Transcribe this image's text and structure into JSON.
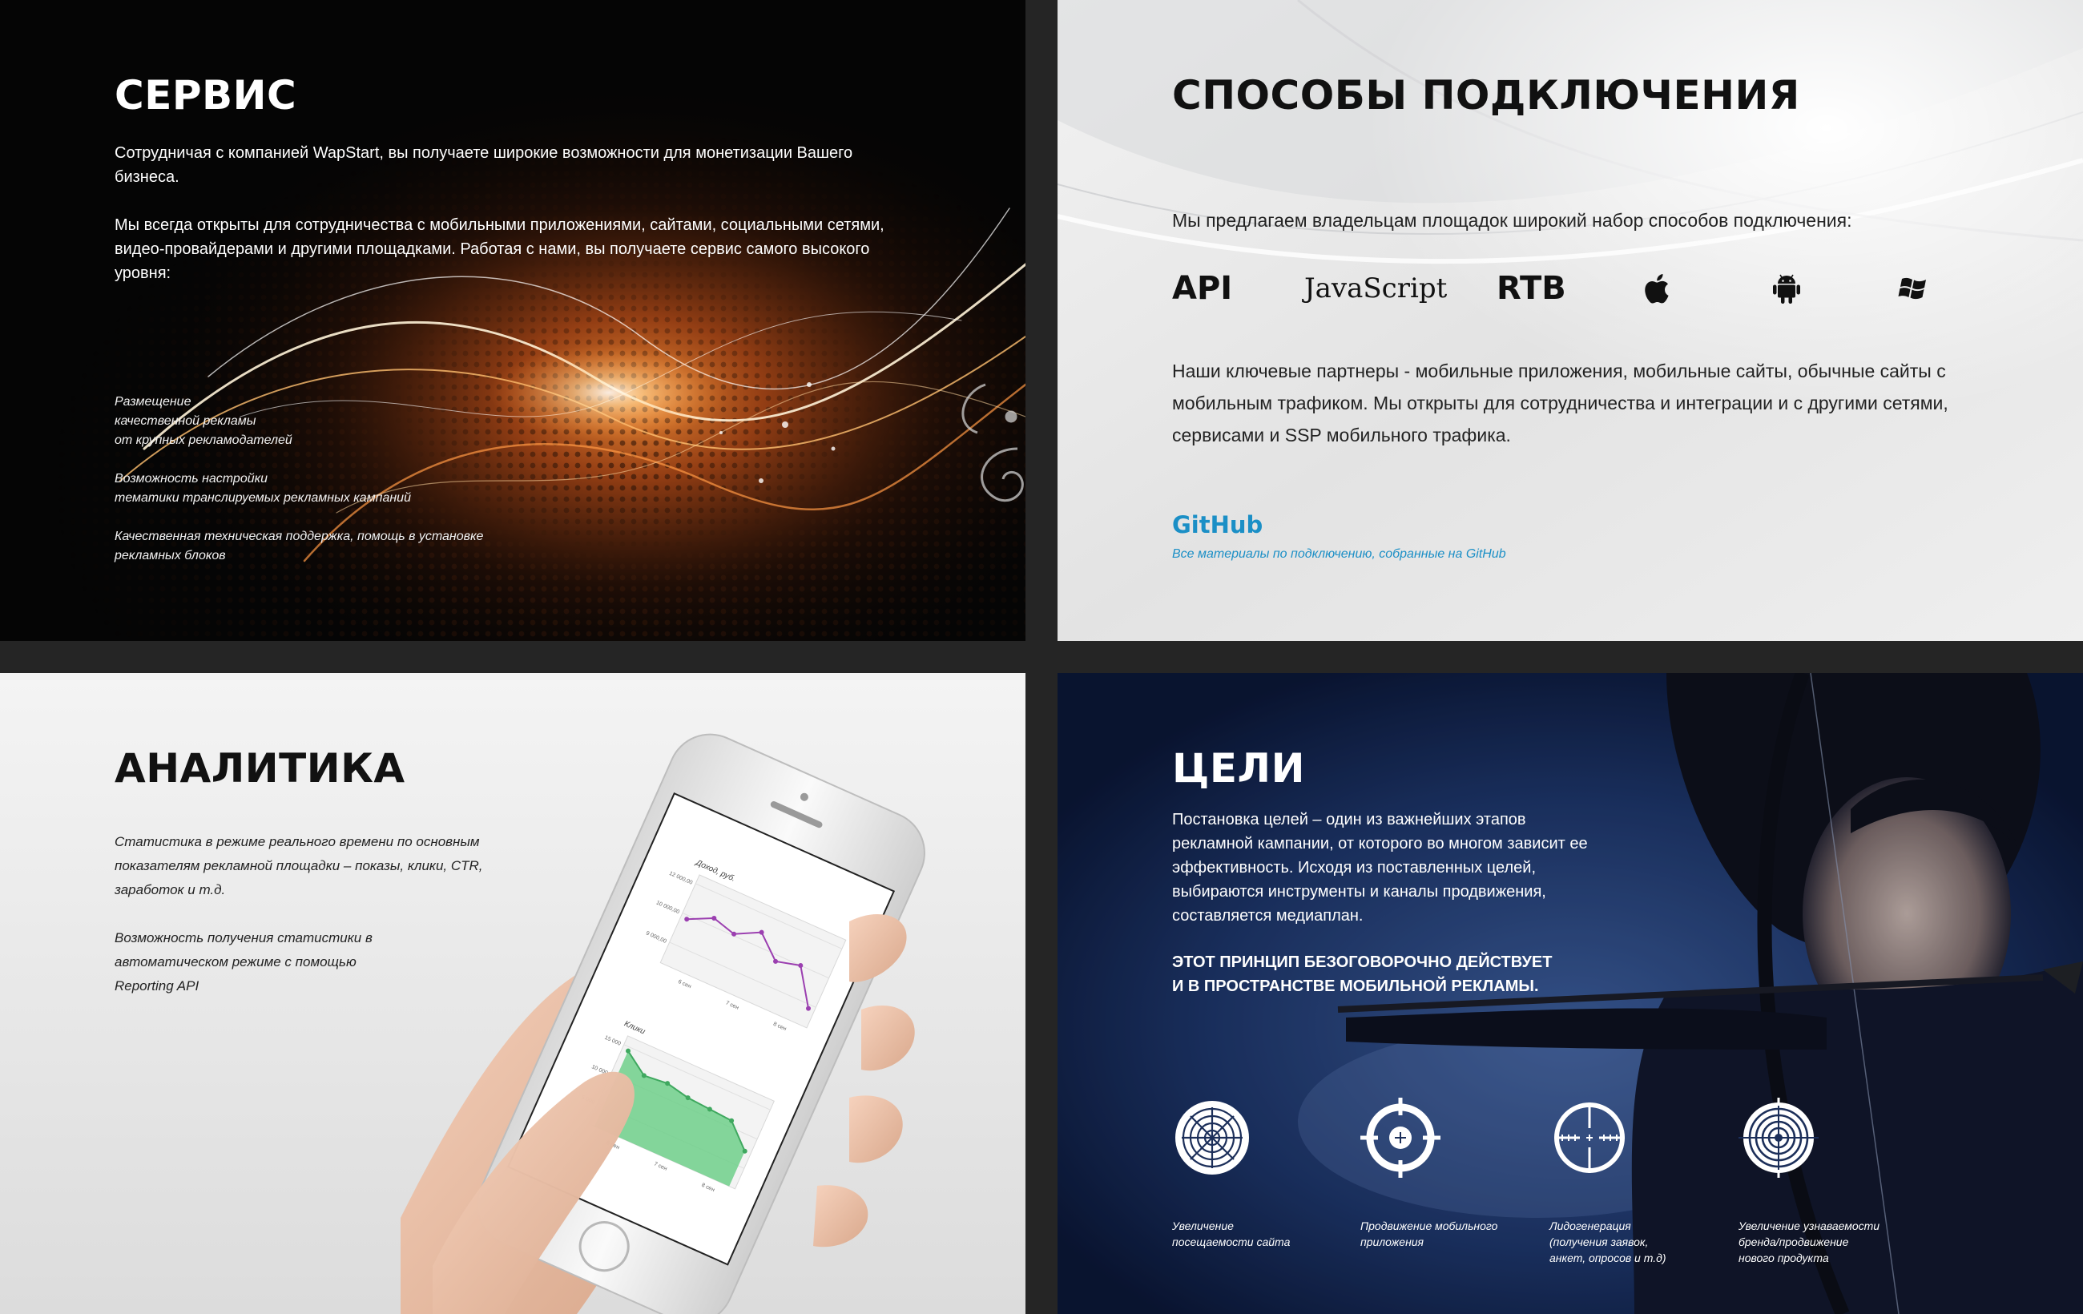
{
  "service": {
    "title": "СЕРВИС",
    "paragraph1": "Сотрудничая с компанией WapStart, вы получаете широкие возможности для монетизации Вашего бизнеса.",
    "paragraph2": "Мы всегда открыты для сотрудничества с мобильными приложениями, сайтами, социальными сетями, видео-провайдерами и другими площадками. Работая с нами, вы получаете сервис самого высокого уровня:",
    "features": [
      "Размещение\nкачественной рекламы\nот крупных рекламодателей",
      "Возможность настройки\nтематики транслируемых рекламных кампаний",
      "Качественная техническая поддержка, помощь в установке\nрекламных блоков"
    ]
  },
  "connect": {
    "title": "СПОСОБЫ ПОДКЛЮЧЕНИЯ",
    "intro": "Мы предлагаем владельцам площадок широкий набор способов подключения:",
    "methods": [
      "API",
      "JavaScript",
      "RTB"
    ],
    "platform_icons": [
      "apple-icon",
      "android-icon",
      "windows-icon"
    ],
    "partners": "Наши ключевые партнеры - мобильные приложения, мобильные сайты, обычные сайты с мобильным трафиком. Мы открыты для сотрудничества и интеграции и с другими сетями, сервисами и SSP мобильного трафика.",
    "github_label": "GitHub",
    "github_sub": "Все материалы по подключению, собранные на GitHub",
    "link_color": "#1b8fc6"
  },
  "analytics": {
    "title": "АНАЛИТИКА",
    "text1": "Статистика в режиме реального времени по основным показателям рекламной площадки – показы, клики, CTR, заработок и т.д.",
    "text2": "Возможность получения статистики в автоматическом режиме с помощью Reporting API",
    "phone_charts": {
      "income": {
        "title": "Доход, руб.",
        "ticks": [
          "12 000,00",
          "10 000,00",
          "9 000,00"
        ],
        "x_labels": [
          "6 сен",
          "7 сен",
          "8 сен"
        ],
        "values": [
          0.55,
          0.7,
          0.62,
          0.78,
          0.52,
          0.6,
          0.15
        ],
        "color": "#9b3fb0"
      },
      "clicks": {
        "title": "Клики",
        "ticks": [
          "15 000",
          "10 000",
          "5 000"
        ],
        "x_labels": [
          "6 сен",
          "7 сен",
          "8 сен"
        ],
        "values": [
          0.95,
          0.75,
          0.78,
          0.72,
          0.7,
          0.68,
          0.4
        ],
        "color": "#6fcf8a"
      }
    }
  },
  "goals": {
    "title": "ЦЕЛИ",
    "text1": "Постановка целей – один из важнейших этапов рекламной кампании, от которого во многом зависит ее эффективность. Исходя из поставленных целей, выбираются инструменты и каналы продвижения, составляется медиаплан.",
    "text2": "Этот принцип безоговорочно действует\nи в пространстве мобильной рекламы.",
    "items": [
      {
        "icon": "target-circles-icon",
        "label": "Увеличение\nпосещаемости сайта"
      },
      {
        "icon": "crosshair-plus-icon",
        "label": "Продвижение мобильного\nприложения"
      },
      {
        "icon": "crosshair-sight-icon",
        "label": "Лидогенерация\n(получения заявок,\nанкет, опросов и т.д)"
      },
      {
        "icon": "bullseye-icon",
        "label": "Увеличение узнаваемости\nбренда/продвижение\nнового продукта"
      }
    ]
  }
}
